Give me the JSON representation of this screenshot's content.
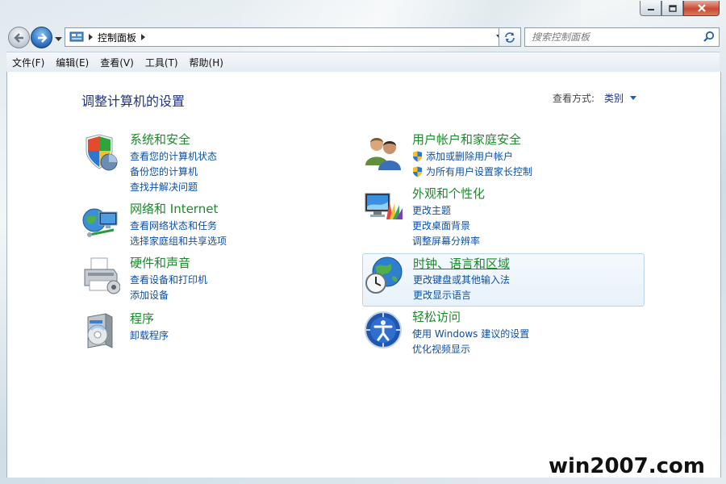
{
  "window": {
    "controls": [
      "minimize",
      "maximize",
      "close"
    ]
  },
  "nav": {
    "breadcrumb": "控制面板",
    "search_placeholder": "搜索控制面板"
  },
  "menu": [
    "文件(F)",
    "编辑(E)",
    "查看(V)",
    "工具(T)",
    "帮助(H)"
  ],
  "content": {
    "title": "调整计算机的设置",
    "view_by_label": "查看方式:",
    "view_by_value": "类别"
  },
  "categories": [
    {
      "icon": "shield-computer-icon",
      "title": "系统和安全",
      "links": [
        "查看您的计算机状态",
        "备份您的计算机",
        "查找并解决问题"
      ]
    },
    {
      "icon": "users-icon",
      "title": "用户帐户和家庭安全",
      "links": [
        "添加或删除用户帐户",
        "为所有用户设置家长控制"
      ],
      "shield_links": true
    },
    {
      "icon": "network-globe-icon",
      "title": "网络和 Internet",
      "links": [
        "查看网络状态和任务",
        "选择家庭组和共享选项"
      ]
    },
    {
      "icon": "monitor-palette-icon",
      "title": "外观和个性化",
      "links": [
        "更改主题",
        "更改桌面背景",
        "调整屏幕分辨率"
      ]
    },
    {
      "icon": "printer-icon",
      "title": "硬件和声音",
      "links": [
        "查看设备和打印机",
        "添加设备"
      ]
    },
    {
      "icon": "clock-globe-icon",
      "title": "时钟、语言和区域",
      "links": [
        "更改键盘或其他输入法",
        "更改显示语言"
      ],
      "highlighted": true
    },
    {
      "icon": "programs-box-icon",
      "title": "程序",
      "links": [
        "卸载程序"
      ]
    },
    {
      "icon": "ease-of-access-icon",
      "title": "轻松访问",
      "links": [
        "使用 Windows 建议的设置",
        "优化视频显示"
      ]
    }
  ],
  "watermark": "win2007.com"
}
